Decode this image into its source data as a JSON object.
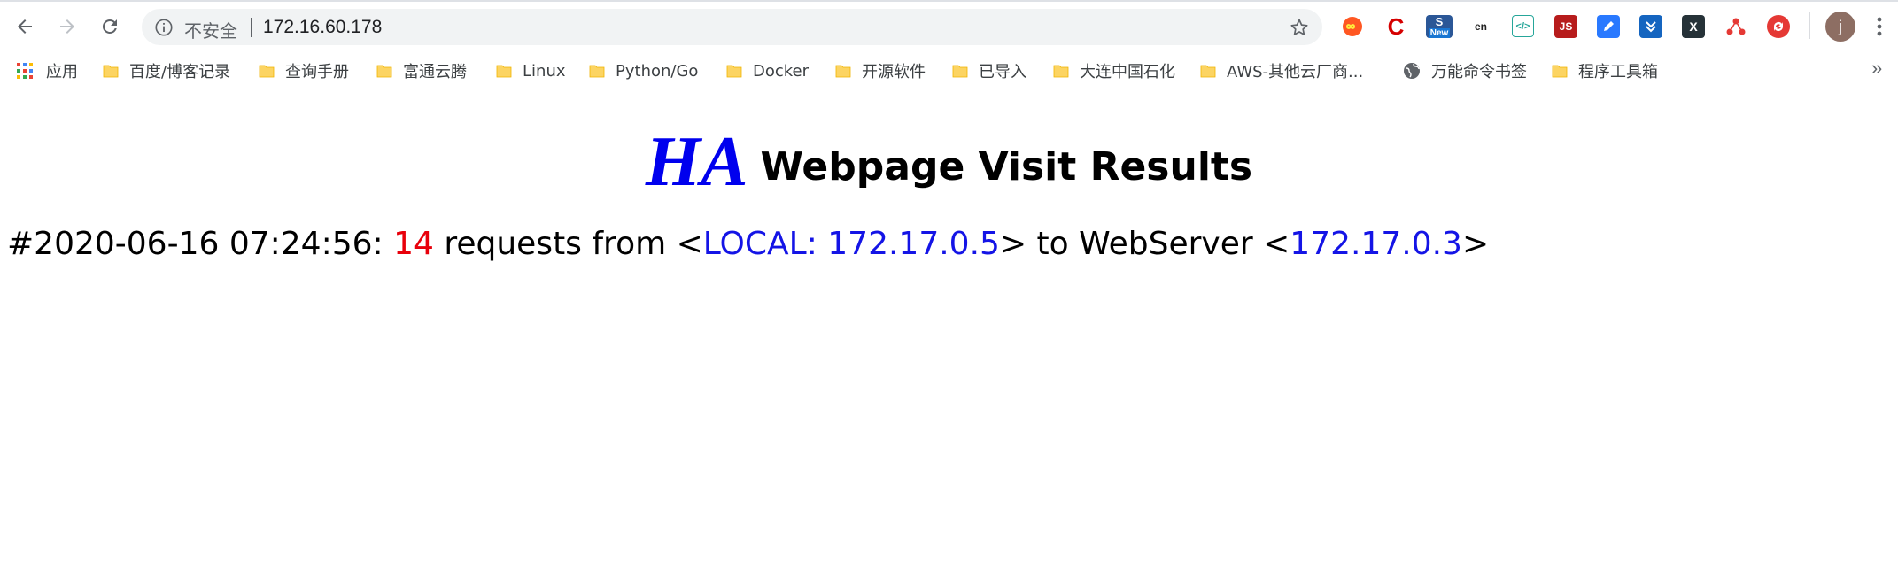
{
  "browser": {
    "security_label": "不安全",
    "url": "172.16.60.178",
    "profile_initial": "j",
    "extensions": [
      {
        "name": "infinity-extension-icon",
        "label": "∞"
      },
      {
        "name": "c-extension-icon",
        "label": "C"
      },
      {
        "name": "new-extension-icon",
        "label": "New"
      },
      {
        "name": "translate-extension-icon",
        "label": "en"
      },
      {
        "name": "code-extension-icon",
        "label": "</>"
      },
      {
        "name": "js-extension-icon",
        "label": "JS"
      },
      {
        "name": "blue-extension-icon",
        "label": ""
      },
      {
        "name": "download-extension-icon",
        "label": ""
      },
      {
        "name": "x-extension-icon",
        "label": "X"
      },
      {
        "name": "network-extension-icon",
        "label": ""
      },
      {
        "name": "sync-extension-icon",
        "label": ""
      }
    ]
  },
  "bookmarks": {
    "apps_label": "应用",
    "items": [
      "百度/博客记录",
      "查询手册",
      "富通云腾",
      "Linux",
      "Python/Go",
      "Docker",
      "开源软件",
      "已导入",
      "大连中国石化",
      "AWS-其他云厂商...",
      "万能命令书签",
      "程序工具箱"
    ],
    "overflow": "»"
  },
  "page": {
    "title_ha": "HA",
    "title_rest": "Webpage Visit Results",
    "visit": {
      "prefix": "#2020-06-16 07:24:56: ",
      "count": "14",
      "middle1": " requests from <",
      "source": "LOCAL: 172.17.0.5",
      "middle2": "> to WebServer <",
      "server": "172.17.0.3",
      "suffix": ">"
    }
  }
}
